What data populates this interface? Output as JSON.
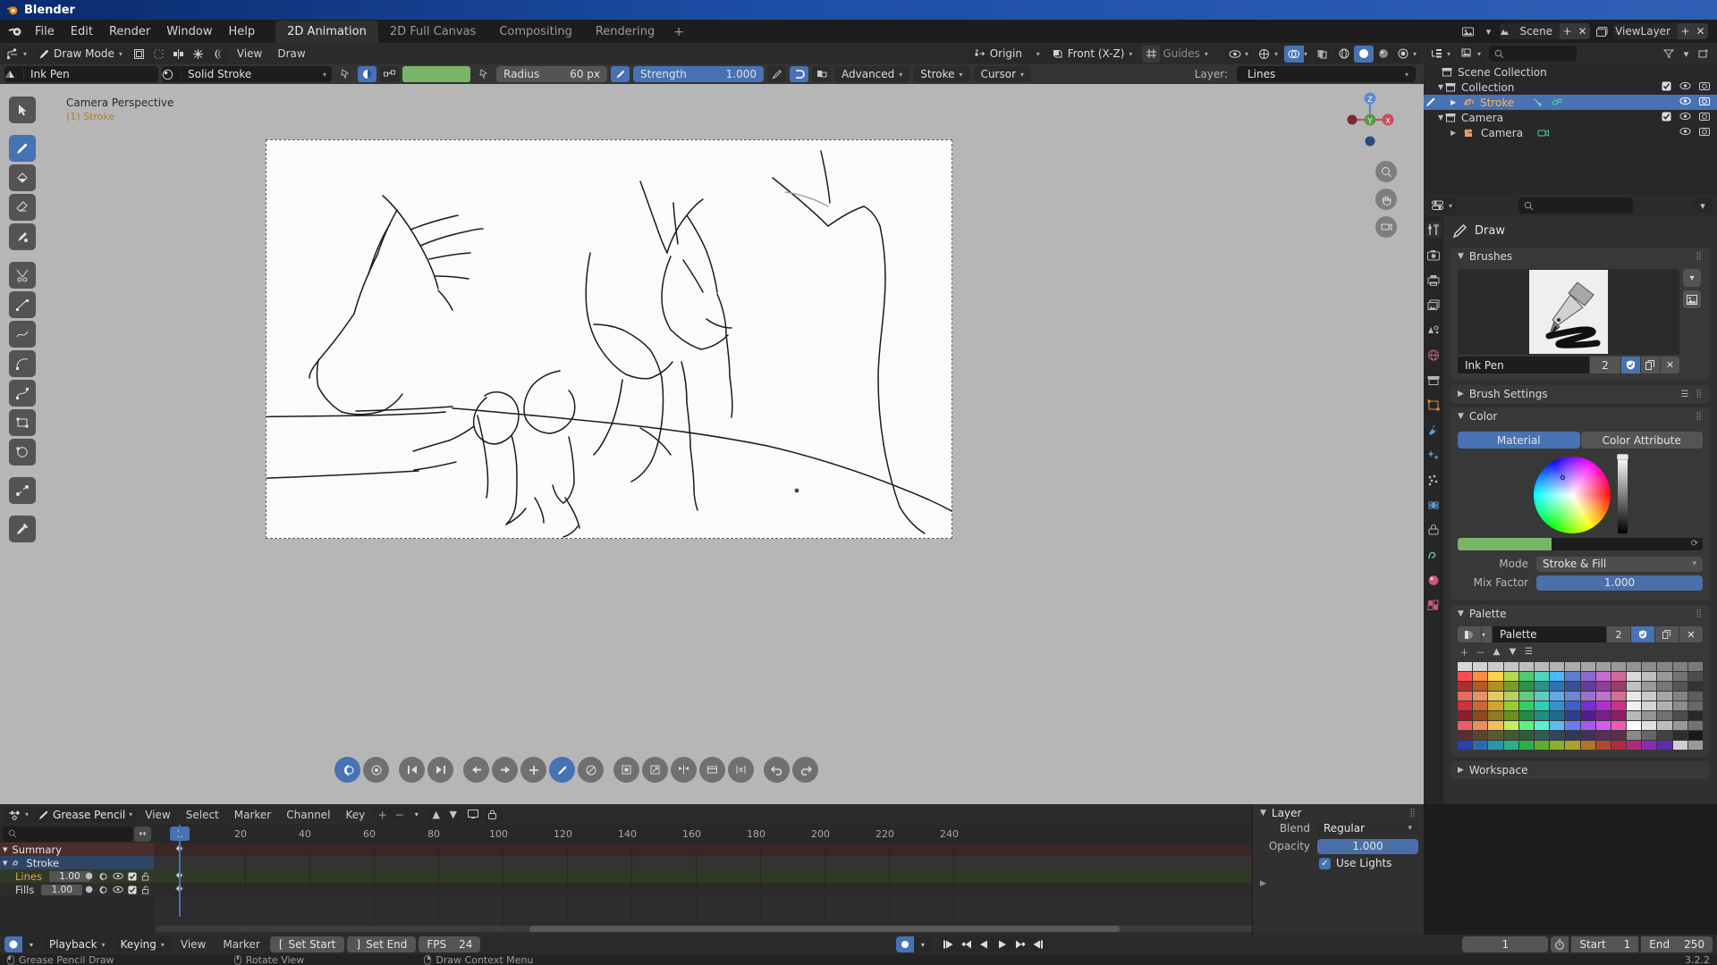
{
  "window": {
    "title": "Blender"
  },
  "topbar": {
    "menus": [
      "File",
      "Edit",
      "Render",
      "Window",
      "Help"
    ],
    "workspaces": [
      {
        "label": "2D Animation",
        "active": true
      },
      {
        "label": "2D Full Canvas",
        "active": false
      },
      {
        "label": "Compositing",
        "active": false
      },
      {
        "label": "Rendering",
        "active": false
      }
    ],
    "add_tab": "+",
    "scene_name": "Scene",
    "viewlayer_name": "ViewLayer",
    "scene_icon": "photo-icon",
    "viewlayer_icon": "images-icon"
  },
  "viewport_header": {
    "mode": "Draw Mode",
    "mode_icon": "pencil-icon",
    "menus": [
      "View",
      "Draw"
    ],
    "pivot": "Origin",
    "orientation": "Front (X-Z)",
    "guides": "Guides",
    "icons": [
      "object-select-icon",
      "dashed-box-icon",
      "mirror-icon",
      "snap-icon",
      "onion-skin-icon"
    ],
    "right_icons": [
      "visibility-icon",
      "overlays-icon",
      "gizmo-icon",
      "xray-icon",
      "shading-wire-icon",
      "shading-solid-icon",
      "shading-material-icon",
      "shading-rendered-icon"
    ]
  },
  "tool_settings": {
    "brush_icon": "brush-icon",
    "brush_name": "Ink Pen",
    "material_icon": "material-sphere-icon",
    "material_name": "Solid Stroke",
    "pin_icon": "pin-icon",
    "pressure_icon": "pressure-icon",
    "unlink_icon": "unlink-icon",
    "color_swatch": "#79b566",
    "radius_label": "Radius",
    "radius_value": "60 px",
    "radius_pressure_icon": "pen-pressure-icon",
    "strength_label": "Strength",
    "strength_value": "1.000",
    "strength_pressure_icon": "pen-pressure-icon",
    "toggle_icons": [
      "stabilizer-icon",
      "occlusion-icon"
    ],
    "advanced": "Advanced",
    "stroke": "Stroke",
    "cursor": "Cursor",
    "layer_label": "Layer:",
    "layer_value": "Lines"
  },
  "viewport": {
    "view_label": "Camera Perspective",
    "active_object": "(1) Stroke",
    "background": "#b6b6b6",
    "canvas_color": "#fbfbfb",
    "gizmo_axes": [
      "Z",
      "Y",
      "X"
    ],
    "tools": [
      {
        "name": "tweak-tool",
        "icon": "cursor-arrow-icon",
        "active": false
      },
      {
        "name": "draw-tool",
        "icon": "pencil-icon",
        "active": true
      },
      {
        "name": "fill-tool",
        "icon": "fill-bucket-icon",
        "active": false
      },
      {
        "name": "erase-tool",
        "icon": "eraser-icon",
        "active": false
      },
      {
        "name": "tint-tool",
        "icon": "tint-brush-icon",
        "active": false
      },
      {
        "name": "cutter-tool",
        "icon": "scissors-icon",
        "active": false
      },
      {
        "name": "line-tool",
        "icon": "line-icon",
        "active": false
      },
      {
        "name": "polyline-tool",
        "icon": "polyline-icon",
        "active": false
      },
      {
        "name": "arc-tool",
        "icon": "arc-icon",
        "active": false
      },
      {
        "name": "curve-tool",
        "icon": "curve-icon",
        "active": false
      },
      {
        "name": "box-tool",
        "icon": "box-icon",
        "active": false
      },
      {
        "name": "circle-tool",
        "icon": "circle-icon",
        "active": false
      },
      {
        "name": "interpolate-tool",
        "icon": "interpolate-icon",
        "active": false
      },
      {
        "name": "eyedropper-tool",
        "icon": "eyedropper-icon",
        "active": false
      }
    ],
    "nav_buttons": [
      "zoom-icon",
      "hand-icon",
      "camera-icon"
    ],
    "playback_pill": [
      {
        "name": "onion-skin-toggle",
        "icon": "onion-icon",
        "active": true
      },
      {
        "name": "ghost-toggle",
        "icon": "ghost-icon",
        "active": false
      },
      {
        "name": "jump-first-frame",
        "icon": "skip-back-icon",
        "active": false
      },
      {
        "name": "jump-last-frame",
        "icon": "skip-forward-icon",
        "active": false
      },
      {
        "name": "prev-keyframe",
        "icon": "arrow-left-icon",
        "active": false
      },
      {
        "name": "next-keyframe",
        "icon": "arrow-right-icon",
        "active": false
      },
      {
        "name": "add-keyframe",
        "icon": "plus-icon",
        "active": false
      },
      {
        "name": "draw-mode-toggle",
        "icon": "pencil-icon",
        "active": true
      },
      {
        "name": "erase-mode-toggle",
        "icon": "eraser-circle-icon",
        "active": false
      },
      {
        "name": "frame-box",
        "icon": "square-icon",
        "active": false
      },
      {
        "name": "transform-frame",
        "icon": "transform-icon",
        "active": false
      },
      {
        "name": "flip-frame",
        "icon": "flip-icon",
        "active": false
      },
      {
        "name": "duplicate-frame",
        "icon": "duplicate-icon",
        "active": false
      },
      {
        "name": "mirror-frame",
        "icon": "mirror-v-icon",
        "active": false
      },
      {
        "name": "undo",
        "icon": "undo-icon",
        "active": false
      },
      {
        "name": "redo",
        "icon": "redo-icon",
        "active": false
      }
    ]
  },
  "outliner": {
    "display_mode_icon": "outliner-icon",
    "filter_mode_icon": "collection-icon",
    "search_placeholder": "",
    "filter_icon": "funnel-icon",
    "new_collection_icon": "new-collection-icon",
    "rows": [
      {
        "label": "Scene Collection",
        "icon": "collection-icon",
        "depth": 0,
        "selected": false,
        "expand": "",
        "checkbox": false,
        "eye": false,
        "camera": false
      },
      {
        "label": "Collection",
        "icon": "collection-icon",
        "depth": 1,
        "selected": false,
        "expand": "down",
        "checkbox": true,
        "eye": true,
        "camera": true
      },
      {
        "label": "Stroke",
        "icon": "gpencil-icon",
        "depth": 2,
        "selected": true,
        "expand": "right",
        "checkbox": false,
        "eye": true,
        "camera": true
      },
      {
        "label": "Camera",
        "icon": "collection-icon",
        "depth": 1,
        "selected": false,
        "expand": "down",
        "checkbox": true,
        "eye": true,
        "camera": true
      },
      {
        "label": "Camera",
        "icon": "camera-icon",
        "depth": 2,
        "selected": false,
        "expand": "right",
        "checkbox": false,
        "eye": true,
        "camera": true
      }
    ]
  },
  "properties": {
    "editor_icon": "properties-icon",
    "search_placeholder": "",
    "tabs": [
      {
        "name": "tool-tab",
        "icon": "tool-icon",
        "active": true
      },
      {
        "name": "render-tab",
        "icon": "camera-back-icon",
        "active": false
      },
      {
        "name": "output-tab",
        "icon": "printer-icon",
        "active": false
      },
      {
        "name": "viewlayer-tab",
        "icon": "images-icon",
        "active": false
      },
      {
        "name": "scene-tab",
        "icon": "cone-sphere-icon",
        "active": false
      },
      {
        "name": "world-tab",
        "icon": "world-icon",
        "active": false
      },
      {
        "name": "collection-tab",
        "icon": "box-icon",
        "active": false
      },
      {
        "name": "object-tab",
        "icon": "orange-square-icon",
        "active": false
      },
      {
        "name": "modifier-tab",
        "icon": "wrench-icon",
        "active": false
      },
      {
        "name": "effects-tab",
        "icon": "fx-icon",
        "active": false
      },
      {
        "name": "particles-tab",
        "icon": "particles-icon",
        "active": false
      },
      {
        "name": "physics-tab",
        "icon": "physics-icon",
        "active": false
      },
      {
        "name": "constraints-tab",
        "icon": "constraint-icon",
        "active": false
      },
      {
        "name": "data-tab",
        "icon": "gpencil-data-icon",
        "active": false
      },
      {
        "name": "material-tab",
        "icon": "material-icon",
        "active": false
      },
      {
        "name": "texture-tab",
        "icon": "checker-icon",
        "active": false
      }
    ],
    "title": "Draw",
    "title_icon": "pencil-icon",
    "brushes_panel": {
      "label": "Brushes",
      "brush_name": "Ink Pen",
      "users_count": "2",
      "shield_icon": "fake-user-icon",
      "copy_icon": "duplicate-icon",
      "close_icon": "x-icon",
      "browse_icon": "chevron-down-icon",
      "preview_icon": "image-icon"
    },
    "brush_settings_panel": {
      "label": "Brush Settings"
    },
    "color_panel": {
      "label": "Color",
      "tabs": [
        {
          "label": "Material",
          "active": true
        },
        {
          "label": "Color Attribute",
          "active": false
        }
      ],
      "current_color": "#79b566",
      "mode_label": "Mode",
      "mode_value": "Stroke & Fill",
      "mix_factor_label": "Mix Factor",
      "mix_factor_value": "1.000"
    },
    "palette_panel": {
      "label": "Palette",
      "name": "Palette",
      "users_count": "2",
      "shield_icon": "fake-user-icon",
      "copy_icon": "duplicate-icon",
      "close_icon": "x-icon",
      "tool_icons": [
        "plus-icon",
        "minus-icon",
        "up-icon",
        "down-icon",
        "sort-icon"
      ],
      "swatch_rows": [
        [
          "#d9d9d9",
          "#d2d2d2",
          "#cccccc",
          "#c6c6c6",
          "#bfbfbf",
          "#b9b9b9",
          "#b3b3b3",
          "#acacac",
          "#a6a6a6",
          "#a0a0a0",
          "#999999",
          "#939393",
          "#8c8c8c",
          "#868686",
          "#808080",
          "#797979"
        ],
        [
          "#ff4d4d",
          "#ff8c42",
          "#ffd24d",
          "#b5d94d",
          "#4dcc6a",
          "#4dd6c0",
          "#4db8ff",
          "#5a7fd4",
          "#8b6ad4",
          "#c96ad4",
          "#d46a9c",
          "#d9d9d9",
          "#bfbfbf",
          "#999999",
          "#737373",
          "#4d4d4d"
        ],
        [
          "#a8312b",
          "#b05a2a",
          "#b0902a",
          "#7a9c2a",
          "#2f8f4a",
          "#2f8f86",
          "#2f72b0",
          "#3a4f99",
          "#5f3f99",
          "#8f3f99",
          "#993f6b",
          "#c0c0c0",
          "#9a9a9a",
          "#777777",
          "#555555",
          "#333333"
        ],
        [
          "#e36d63",
          "#e39363",
          "#e3c963",
          "#b7cf63",
          "#63c981",
          "#63c9c0",
          "#63a9e3",
          "#6f85cf",
          "#9672cf",
          "#bd72cf",
          "#cf7296",
          "#e8e8e8",
          "#cacaca",
          "#a6a6a6",
          "#828282",
          "#5e5e5e"
        ],
        [
          "#cf2f3f",
          "#cf662f",
          "#cfa52f",
          "#92cf2f",
          "#2fcf62",
          "#2fcfb4",
          "#2f93cf",
          "#3f5fcf",
          "#742fcf",
          "#b02fcf",
          "#cf2f8a",
          "#f0f0f0",
          "#d4d4d4",
          "#b0b0b0",
          "#8c8c8c",
          "#686868"
        ],
        [
          "#8f1d2b",
          "#8f4a1d",
          "#8f7a1d",
          "#6b8f1d",
          "#1d8f42",
          "#1d8f7e",
          "#1d6b8f",
          "#2a3f8f",
          "#4f1d8f",
          "#7c1d8f",
          "#8f1d63",
          "#b8b8b8",
          "#949494",
          "#707070",
          "#4c4c4c",
          "#282828"
        ],
        [
          "#ef5b6b",
          "#ef8a5b",
          "#efc15b",
          "#c2ef5b",
          "#5bef86",
          "#5befd0",
          "#5bbcef",
          "#6b7cef",
          "#a05bef",
          "#d45bef",
          "#ef5bb0",
          "#ffffff",
          "#e0e0e0",
          "#bcbcbc",
          "#989898",
          "#747474"
        ],
        [
          "#5a2f2f",
          "#5a432f",
          "#5a5a2f",
          "#435a2f",
          "#2f5a3c",
          "#2f5a56",
          "#2f475a",
          "#2f3a5a",
          "#432f5a",
          "#562f5a",
          "#5a2f47",
          "#8a8a8a",
          "#666666",
          "#424242",
          "#2e2e2e",
          "#1a1a1a"
        ],
        [
          "#2b3fb0",
          "#2b6ab0",
          "#2b95b0",
          "#2bb08a",
          "#2bb04a",
          "#5ab02b",
          "#8ab02b",
          "#b0a02b",
          "#b0752b",
          "#b04a2b",
          "#b02b3f",
          "#b02b7a",
          "#8a2bb0",
          "#5f2bb0",
          "#d0d0d0",
          "#9a9a9a"
        ]
      ]
    },
    "workspace_panel": {
      "label": "Workspace"
    }
  },
  "dopesheet": {
    "editor_icon": "dopesheet-icon",
    "mode": "Grease Pencil",
    "mode_icon": "pencil-icon",
    "menus": [
      "View",
      "Select",
      "Marker",
      "Channel",
      "Key"
    ],
    "header_icons": [
      "plus-icon",
      "minus-icon",
      "chevron-down-icon",
      "up-icon",
      "down-icon",
      "only-show-selected-icon",
      "lock-icon"
    ],
    "right_icons": [
      "ghost-icon",
      "filter-icon",
      "funnel-icon",
      "proportional-icon",
      "falloff-icon"
    ],
    "search_placeholder": "",
    "channels": [
      {
        "label": "Summary",
        "type": "summary",
        "expand": "down"
      },
      {
        "label": "Stroke",
        "type": "object",
        "expand": "down",
        "icon": "gpencil-icon"
      },
      {
        "label": "Lines",
        "type": "layer-green",
        "value": "1.00"
      },
      {
        "label": "Fills",
        "type": "layer",
        "value": "1.00"
      }
    ],
    "ruler_ticks": [
      "1",
      "20",
      "40",
      "60",
      "80",
      "100",
      "120",
      "140",
      "160",
      "180",
      "200",
      "220",
      "240"
    ],
    "current_frame_badge": "1",
    "keyframes_at_frame": 1
  },
  "layer_panel": {
    "label": "Layer",
    "blend_label": "Blend",
    "blend_value": "Regular",
    "opacity_label": "Opacity",
    "opacity_value": "1.000",
    "use_lights_label": "Use Lights",
    "use_lights_checked": true
  },
  "timeline_bar": {
    "record_icon": "record-icon",
    "playback": "Playback",
    "keying": "Keying",
    "menus": [
      "View",
      "Marker"
    ],
    "set_start": "Set Start",
    "set_end": "Set End",
    "fps_label": "FPS",
    "fps_value": "24",
    "transport_icons": [
      "jump-start-icon",
      "prev-keyframe-icon",
      "play-reverse-icon",
      "play-icon",
      "next-keyframe-icon",
      "jump-end-icon"
    ],
    "current_frame": "1",
    "timer_icon": "stopwatch-icon",
    "start_label": "Start",
    "start_value": "1",
    "end_label": "End",
    "end_value": "250"
  },
  "statusbar": {
    "hints": [
      {
        "mouse": "left",
        "text": "Grease Pencil Draw"
      },
      {
        "mouse": "middle",
        "text": "Rotate View"
      },
      {
        "mouse": "right",
        "text": "Draw Context Menu"
      }
    ],
    "version": "3.2.2"
  }
}
